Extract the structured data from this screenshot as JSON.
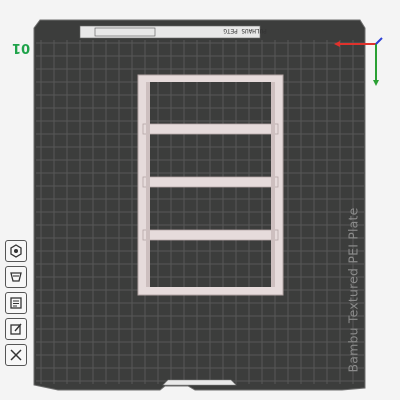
{
  "plate": {
    "number": "01",
    "label": "Bambu Textured PEI Plate",
    "header_text": "PULHAUS PETG"
  },
  "toolbar": {
    "items": [
      {
        "name": "orient-icon"
      },
      {
        "name": "arrange-icon"
      },
      {
        "name": "layers-icon"
      },
      {
        "name": "edit-icon"
      },
      {
        "name": "close-icon"
      }
    ]
  },
  "axes": {
    "x_color": "#e0322c",
    "y_color": "#2aa033",
    "z_color": "#2b3fd6"
  },
  "colors": {
    "plate": "#3c3d3c",
    "grid": "#575857",
    "model": "#e6dbdb",
    "model_edge": "#b3a5a5"
  }
}
